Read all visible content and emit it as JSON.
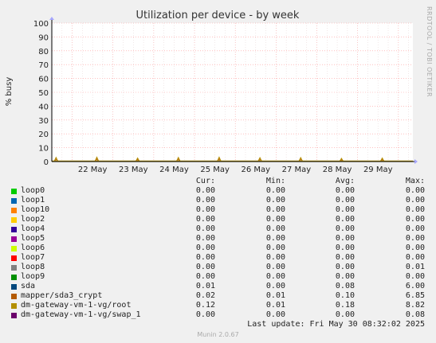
{
  "chart_data": {
    "type": "area",
    "title": "Utilization per device - by week",
    "ylabel": "% busy",
    "side_text": "RRDTOOL / TOBI OETIKER",
    "ylim": [
      0,
      100
    ],
    "yticks": [
      0,
      10,
      20,
      30,
      40,
      50,
      60,
      70,
      80,
      90,
      100
    ],
    "xlim": [
      "2025-05-21 12:00",
      "2025-05-30 08:32"
    ],
    "xticks": [
      "22 May",
      "23 May",
      "24 May",
      "25 May",
      "26 May",
      "27 May",
      "28 May",
      "29 May"
    ],
    "grid": true,
    "legend_headers": [
      "Cur:",
      "Min:",
      "Avg:",
      "Max:"
    ],
    "series": [
      {
        "name": "loop0",
        "color": "#00cc00",
        "cur": "0.00",
        "min": "0.00",
        "avg": "0.00",
        "max": "0.00"
      },
      {
        "name": "loop1",
        "color": "#0066b3",
        "cur": "0.00",
        "min": "0.00",
        "avg": "0.00",
        "max": "0.00"
      },
      {
        "name": "loop10",
        "color": "#ff8000",
        "cur": "0.00",
        "min": "0.00",
        "avg": "0.00",
        "max": "0.00"
      },
      {
        "name": "loop2",
        "color": "#ffcc00",
        "cur": "0.00",
        "min": "0.00",
        "avg": "0.00",
        "max": "0.00"
      },
      {
        "name": "loop4",
        "color": "#330099",
        "cur": "0.00",
        "min": "0.00",
        "avg": "0.00",
        "max": "0.00"
      },
      {
        "name": "loop5",
        "color": "#990099",
        "cur": "0.00",
        "min": "0.00",
        "avg": "0.00",
        "max": "0.00"
      },
      {
        "name": "loop6",
        "color": "#ccff00",
        "cur": "0.00",
        "min": "0.00",
        "avg": "0.00",
        "max": "0.00"
      },
      {
        "name": "loop7",
        "color": "#ff0000",
        "cur": "0.00",
        "min": "0.00",
        "avg": "0.00",
        "max": "0.00"
      },
      {
        "name": "loop8",
        "color": "#808080",
        "cur": "0.00",
        "min": "0.00",
        "avg": "0.00",
        "max": "0.01"
      },
      {
        "name": "loop9",
        "color": "#008f00",
        "cur": "0.00",
        "min": "0.00",
        "avg": "0.00",
        "max": "0.00"
      },
      {
        "name": "sda",
        "color": "#00487d",
        "cur": "0.01",
        "min": "0.00",
        "avg": "0.08",
        "max": "6.00"
      },
      {
        "name": "mapper/sda3_crypt",
        "color": "#b35a00",
        "cur": "0.02",
        "min": "0.01",
        "avg": "0.10",
        "max": "6.85"
      },
      {
        "name": "dm-gateway-vm-1-vg/root",
        "color": "#b38f00",
        "cur": "0.12",
        "min": "0.01",
        "avg": "0.18",
        "max": "8.82"
      },
      {
        "name": "dm-gateway-vm-1-vg/swap_1",
        "color": "#6b006b",
        "cur": "0.00",
        "min": "0.00",
        "avg": "0.00",
        "max": "0.08"
      }
    ],
    "spikes": [
      {
        "t": "2025-05-21 14:30",
        "v": 3.0
      },
      {
        "t": "2025-05-22 14:30",
        "v": 3.2
      },
      {
        "t": "2025-05-23 14:30",
        "v": 2.6
      },
      {
        "t": "2025-05-24 14:30",
        "v": 3.0
      },
      {
        "t": "2025-05-25 14:30",
        "v": 3.2
      },
      {
        "t": "2025-05-26 14:30",
        "v": 2.8
      },
      {
        "t": "2025-05-27 14:30",
        "v": 2.9
      },
      {
        "t": "2025-05-28 14:30",
        "v": 2.3
      },
      {
        "t": "2025-05-29 14:30",
        "v": 2.6
      }
    ]
  },
  "footer": {
    "last_update": "Last update: Fri May 30 08:32:02 2025",
    "munin_version": "Munin 2.0.67"
  }
}
